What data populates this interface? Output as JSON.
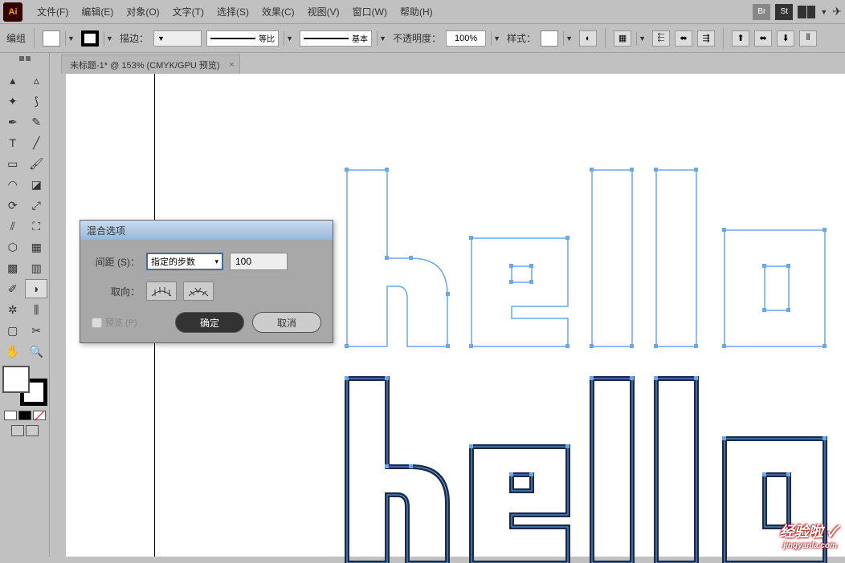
{
  "app": {
    "logo": "Ai"
  },
  "menu": {
    "file": "文件(F)",
    "edit": "编辑(E)",
    "object": "对象(O)",
    "type": "文字(T)",
    "select": "选择(S)",
    "effect": "效果(C)",
    "view": "视图(V)",
    "window": "窗口(W)",
    "help": "帮助(H)",
    "br": "Br",
    "st": "St"
  },
  "control": {
    "mode": "编组",
    "stroke_label": "描边：",
    "uniform": "等比",
    "basic": "基本",
    "opacity_label": "不透明度：",
    "opacity_value": "100%",
    "style_label": "样式："
  },
  "tab": {
    "title": "未标题-1* @ 153% (CMYK/GPU 预览)",
    "close": "×"
  },
  "dialog": {
    "title": "混合选项",
    "spacing_label": "间距 (S)：",
    "spacing_mode": "指定的步数",
    "spacing_value": "100",
    "orientation_label": "取向：",
    "orient1": "⫨⫨⫨",
    "orient2": "⟋⟋⟋",
    "preview": "预览 (P)",
    "ok": "确定",
    "cancel": "取消"
  },
  "watermark": {
    "main": "经验啦 ✓",
    "sub": "jingyanla.com"
  }
}
